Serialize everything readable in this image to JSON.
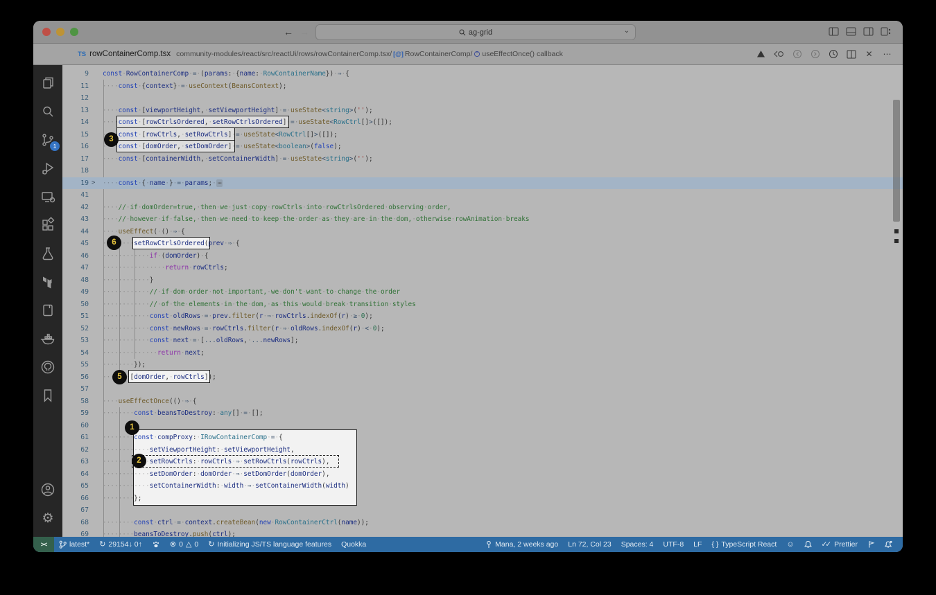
{
  "titlebar": {
    "search_value": "ag-grid"
  },
  "tab": {
    "file_type": "TS",
    "file_name": "rowContainerComp.tsx",
    "path": "community-modules/react/src/reactUi/rows/rowContainerComp.tsx/",
    "crumb_symbol_1": "[@]",
    "crumb_component": "RowContainerComp/",
    "crumb_callback": "useEffectOnce() callback"
  },
  "annotations": {
    "b1": "1",
    "b2": "2",
    "b3": "3",
    "b5": "5",
    "b6": "6"
  },
  "activity": {
    "scm_badge": "1"
  },
  "status": {
    "remote": "><",
    "branch": "latest*",
    "sync": "29154↓ 0↑",
    "errors": "0",
    "warnings": "0",
    "init": "Initializing JS/TS language features",
    "quokka": "Quokka",
    "blame": "Mana, 2 weeks ago",
    "cursor": "Ln 72, Col 23",
    "spaces": "Spaces: 4",
    "encoding": "UTF-8",
    "eol": "LF",
    "braces": "{ }",
    "lang": "TypeScript React",
    "checks": "✓✓",
    "prettier": "Prettier"
  },
  "editor": {
    "lines": [
      {
        "n": 9,
        "ind": 0,
        "t": [
          [
            "kw",
            "const"
          ],
          [
            "var",
            " RowContainerComp"
          ],
          [
            "op",
            " = "
          ],
          [
            "pn",
            "("
          ],
          [
            "var",
            "params"
          ],
          [
            "pn",
            ": {"
          ],
          [
            "var",
            "name"
          ],
          [
            "pn",
            ": "
          ],
          [
            "type",
            "RowContainerName"
          ],
          [
            "pn",
            "}) "
          ],
          [
            "op",
            "⇒"
          ],
          [
            "pn",
            " {"
          ]
        ]
      },
      {
        "n": 11,
        "ind": 4,
        "t": [
          [
            "kw",
            "const"
          ],
          [
            "pn",
            " {"
          ],
          [
            "var",
            "context"
          ],
          [
            "pn",
            "} "
          ],
          [
            "op",
            "= "
          ],
          [
            "fn",
            "useContext"
          ],
          [
            "pn",
            "("
          ],
          [
            "fn",
            "BeansContext"
          ],
          [
            "pn",
            ");"
          ]
        ]
      },
      {
        "n": 12,
        "ind": 0,
        "t": []
      },
      {
        "n": 13,
        "ind": 4,
        "t": [
          [
            "kw",
            "const"
          ],
          [
            "pn",
            " ["
          ],
          [
            "var",
            "viewportHeight"
          ],
          [
            "pn",
            ", "
          ],
          [
            "var",
            "setViewportHeight"
          ],
          [
            "pn",
            "] "
          ],
          [
            "op",
            "= "
          ],
          [
            "fn",
            "useState"
          ],
          [
            "op",
            "<"
          ],
          [
            "type",
            "string"
          ],
          [
            "op",
            ">"
          ],
          [
            "pn",
            "("
          ],
          [
            "str",
            "''"
          ],
          [
            "pn",
            ");"
          ]
        ]
      },
      {
        "n": 14,
        "ind": 4,
        "t": [
          [
            "kw",
            "const"
          ],
          [
            "pn",
            " ["
          ],
          [
            "var",
            "rowCtrlsOrdered"
          ],
          [
            "pn",
            ", "
          ],
          [
            "var",
            "setRowCtrlsOrdered"
          ],
          [
            "pn",
            "] "
          ],
          [
            "op",
            "= "
          ],
          [
            "fn",
            "useState"
          ],
          [
            "op",
            "<"
          ],
          [
            "type",
            "RowCtrl"
          ],
          [
            "pn",
            "[]"
          ],
          [
            "op",
            ">"
          ],
          [
            "pn",
            "([]);"
          ]
        ]
      },
      {
        "n": 15,
        "ind": 4,
        "t": [
          [
            "kw",
            "const"
          ],
          [
            "pn",
            " ["
          ],
          [
            "var",
            "rowCtrls"
          ],
          [
            "pn",
            ", "
          ],
          [
            "var",
            "setRowCtrls"
          ],
          [
            "pn",
            "] "
          ],
          [
            "op",
            "= "
          ],
          [
            "fn",
            "useState"
          ],
          [
            "op",
            "<"
          ],
          [
            "type",
            "RowCtrl"
          ],
          [
            "pn",
            "[]"
          ],
          [
            "op",
            ">"
          ],
          [
            "pn",
            "([]);"
          ]
        ]
      },
      {
        "n": 16,
        "ind": 4,
        "t": [
          [
            "kw",
            "const"
          ],
          [
            "pn",
            " ["
          ],
          [
            "var",
            "domOrder"
          ],
          [
            "pn",
            ", "
          ],
          [
            "var",
            "setDomOrder"
          ],
          [
            "pn",
            "] "
          ],
          [
            "op",
            "= "
          ],
          [
            "fn",
            "useState"
          ],
          [
            "op",
            "<"
          ],
          [
            "type",
            "boolean"
          ],
          [
            "op",
            ">"
          ],
          [
            "pn",
            "("
          ],
          [
            "kw",
            "false"
          ],
          [
            "pn",
            ");"
          ]
        ]
      },
      {
        "n": 17,
        "ind": 4,
        "t": [
          [
            "kw",
            "const"
          ],
          [
            "pn",
            " ["
          ],
          [
            "var",
            "containerWidth"
          ],
          [
            "pn",
            ", "
          ],
          [
            "var",
            "setContainerWidth"
          ],
          [
            "pn",
            "] "
          ],
          [
            "op",
            "= "
          ],
          [
            "fn",
            "useState"
          ],
          [
            "op",
            "<"
          ],
          [
            "type",
            "string"
          ],
          [
            "op",
            ">"
          ],
          [
            "pn",
            "("
          ],
          [
            "str",
            "''"
          ],
          [
            "pn",
            ");"
          ]
        ]
      },
      {
        "n": 18,
        "ind": 0,
        "t": []
      },
      {
        "n": 19,
        "ind": 4,
        "hl": true,
        "fold": true,
        "t": [
          [
            "kw",
            "const"
          ],
          [
            "pn",
            " { "
          ],
          [
            "var",
            "name"
          ],
          [
            "pn",
            " } "
          ],
          [
            "op",
            "= "
          ],
          [
            "var",
            "params"
          ],
          [
            "pn",
            "; "
          ],
          [
            "fold",
            "⋯"
          ]
        ]
      },
      {
        "n": 41,
        "ind": 0,
        "t": []
      },
      {
        "n": 42,
        "ind": 4,
        "t": [
          [
            "cm",
            "// if domOrder=true, then we just copy rowCtrls into rowCtrlsOrdered observing order,"
          ]
        ]
      },
      {
        "n": 43,
        "ind": 4,
        "t": [
          [
            "cm",
            "// however if false, then we need to keep the order as they are in the dom, otherwise rowAnimation breaks"
          ]
        ]
      },
      {
        "n": 44,
        "ind": 4,
        "t": [
          [
            "fn",
            "useEffect"
          ],
          [
            "pn",
            "( () "
          ],
          [
            "op",
            "⇒"
          ],
          [
            "pn",
            " {"
          ]
        ]
      },
      {
        "n": 45,
        "ind": 8,
        "t": [
          [
            "var",
            "setRowCtrlsOrdered"
          ],
          [
            "pn",
            "("
          ],
          [
            "var",
            "prev"
          ],
          [
            "op",
            " ⇒"
          ],
          [
            "pn",
            " {"
          ]
        ]
      },
      {
        "n": 46,
        "ind": 12,
        "t": [
          [
            "ctrl",
            "if"
          ],
          [
            "pn",
            " ("
          ],
          [
            "var",
            "domOrder"
          ],
          [
            "pn",
            ") {"
          ]
        ]
      },
      {
        "n": 47,
        "ind": 16,
        "t": [
          [
            "ctrl",
            "return"
          ],
          [
            "var",
            " rowCtrls"
          ],
          [
            "pn",
            ";"
          ]
        ]
      },
      {
        "n": 48,
        "ind": 12,
        "t": [
          [
            "pn",
            "}"
          ]
        ]
      },
      {
        "n": 49,
        "ind": 12,
        "t": [
          [
            "cm",
            "// if dom order not important, we don't want to change the order"
          ]
        ]
      },
      {
        "n": 50,
        "ind": 12,
        "t": [
          [
            "cm",
            "// of the elements in the dom, as this would break transition styles"
          ]
        ]
      },
      {
        "n": 51,
        "ind": 12,
        "t": [
          [
            "kw",
            "const"
          ],
          [
            "var",
            " oldRows"
          ],
          [
            "op",
            " = "
          ],
          [
            "var",
            "prev"
          ],
          [
            "pn",
            "."
          ],
          [
            "fn",
            "filter"
          ],
          [
            "pn",
            "("
          ],
          [
            "var",
            "r"
          ],
          [
            "op",
            " ⇒ "
          ],
          [
            "var",
            "rowCtrls"
          ],
          [
            "pn",
            "."
          ],
          [
            "fn",
            "indexOf"
          ],
          [
            "pn",
            "("
          ],
          [
            "var",
            "r"
          ],
          [
            "pn",
            ") "
          ],
          [
            "op",
            "≥"
          ],
          [
            "num",
            " 0"
          ],
          [
            "pn",
            ");"
          ]
        ]
      },
      {
        "n": 52,
        "ind": 12,
        "t": [
          [
            "kw",
            "const"
          ],
          [
            "var",
            " newRows"
          ],
          [
            "op",
            " = "
          ],
          [
            "var",
            "rowCtrls"
          ],
          [
            "pn",
            "."
          ],
          [
            "fn",
            "filter"
          ],
          [
            "pn",
            "("
          ],
          [
            "var",
            "r"
          ],
          [
            "op",
            " ⇒ "
          ],
          [
            "var",
            "oldRows"
          ],
          [
            "pn",
            "."
          ],
          [
            "fn",
            "indexOf"
          ],
          [
            "pn",
            "("
          ],
          [
            "var",
            "r"
          ],
          [
            "pn",
            ") "
          ],
          [
            "op",
            "<"
          ],
          [
            "num",
            " 0"
          ],
          [
            "pn",
            ");"
          ]
        ]
      },
      {
        "n": 53,
        "ind": 12,
        "t": [
          [
            "kw",
            "const"
          ],
          [
            "var",
            " next"
          ],
          [
            "op",
            " = "
          ],
          [
            "pn",
            "["
          ],
          [
            "op",
            "..."
          ],
          [
            "var",
            "oldRows"
          ],
          [
            "pn",
            ", "
          ],
          [
            "op",
            "..."
          ],
          [
            "var",
            "newRows"
          ],
          [
            "pn",
            "];"
          ]
        ]
      },
      {
        "n": 54,
        "ind": 14,
        "t": [
          [
            "ctrl",
            "return"
          ],
          [
            "var",
            " next"
          ],
          [
            "pn",
            ";"
          ]
        ]
      },
      {
        "n": 55,
        "ind": 8,
        "t": [
          [
            "pn",
            "});"
          ]
        ]
      },
      {
        "n": 56,
        "ind": 4,
        "t": [
          [
            "pn",
            "}, ["
          ],
          [
            "var",
            "domOrder"
          ],
          [
            "pn",
            ", "
          ],
          [
            "var",
            "rowCtrls"
          ],
          [
            "pn",
            "]);"
          ]
        ]
      },
      {
        "n": 57,
        "ind": 0,
        "t": []
      },
      {
        "n": 58,
        "ind": 4,
        "t": [
          [
            "fn",
            "useEffectOnce"
          ],
          [
            "pn",
            "(() "
          ],
          [
            "op",
            "⇒"
          ],
          [
            "pn",
            " {"
          ]
        ]
      },
      {
        "n": 59,
        "ind": 8,
        "t": [
          [
            "kw",
            "const"
          ],
          [
            "var",
            " beansToDestroy"
          ],
          [
            "pn",
            ": "
          ],
          [
            "type",
            "any"
          ],
          [
            "pn",
            "[] "
          ],
          [
            "op",
            "= "
          ],
          [
            "pn",
            "[];"
          ]
        ]
      },
      {
        "n": 60,
        "ind": 0,
        "t": []
      },
      {
        "n": 61,
        "ind": 8,
        "t": [
          [
            "kw",
            "const"
          ],
          [
            "var",
            " compProxy"
          ],
          [
            "pn",
            ": "
          ],
          [
            "type",
            "IRowContainerComp"
          ],
          [
            "op",
            " = "
          ],
          [
            "pn",
            "{"
          ]
        ]
      },
      {
        "n": 62,
        "ind": 12,
        "t": [
          [
            "var",
            "setViewportHeight"
          ],
          [
            "pn",
            ": "
          ],
          [
            "var",
            "setViewportHeight"
          ],
          [
            "pn",
            ","
          ]
        ]
      },
      {
        "n": 63,
        "ind": 12,
        "t": [
          [
            "var",
            "setRowCtrls"
          ],
          [
            "pn",
            ": "
          ],
          [
            "var",
            "rowCtrls"
          ],
          [
            "op",
            " ⇒ "
          ],
          [
            "var",
            "setRowCtrls"
          ],
          [
            "pn",
            "("
          ],
          [
            "var",
            "rowCtrls"
          ],
          [
            "pn",
            "),"
          ]
        ]
      },
      {
        "n": 64,
        "ind": 12,
        "t": [
          [
            "var",
            "setDomOrder"
          ],
          [
            "pn",
            ": "
          ],
          [
            "var",
            "domOrder"
          ],
          [
            "op",
            " ⇒ "
          ],
          [
            "var",
            "setDomOrder"
          ],
          [
            "pn",
            "("
          ],
          [
            "var",
            "domOrder"
          ],
          [
            "pn",
            "),"
          ]
        ]
      },
      {
        "n": 65,
        "ind": 12,
        "t": [
          [
            "var",
            "setContainerWidth"
          ],
          [
            "pn",
            ": "
          ],
          [
            "var",
            "width"
          ],
          [
            "op",
            " ⇒ "
          ],
          [
            "var",
            "setContainerWidth"
          ],
          [
            "pn",
            "("
          ],
          [
            "var",
            "width"
          ],
          [
            "pn",
            ")"
          ]
        ]
      },
      {
        "n": 66,
        "ind": 8,
        "t": [
          [
            "pn",
            "};"
          ]
        ]
      },
      {
        "n": 67,
        "ind": 0,
        "t": []
      },
      {
        "n": 68,
        "ind": 8,
        "t": [
          [
            "kw",
            "const"
          ],
          [
            "var",
            " ctrl"
          ],
          [
            "op",
            " = "
          ],
          [
            "var",
            "context"
          ],
          [
            "pn",
            "."
          ],
          [
            "fn",
            "createBean"
          ],
          [
            "pn",
            "("
          ],
          [
            "kw",
            "new"
          ],
          [
            "type",
            " RowContainerCtrl"
          ],
          [
            "pn",
            "("
          ],
          [
            "var",
            "name"
          ],
          [
            "pn",
            "));"
          ]
        ]
      },
      {
        "n": 69,
        "ind": 8,
        "t": [
          [
            "var",
            "beansToDestroy"
          ],
          [
            "pn",
            "."
          ],
          [
            "fn",
            "push"
          ],
          [
            "pn",
            "("
          ],
          [
            "var",
            "ctrl"
          ],
          [
            "pn",
            ");"
          ]
        ]
      }
    ]
  }
}
